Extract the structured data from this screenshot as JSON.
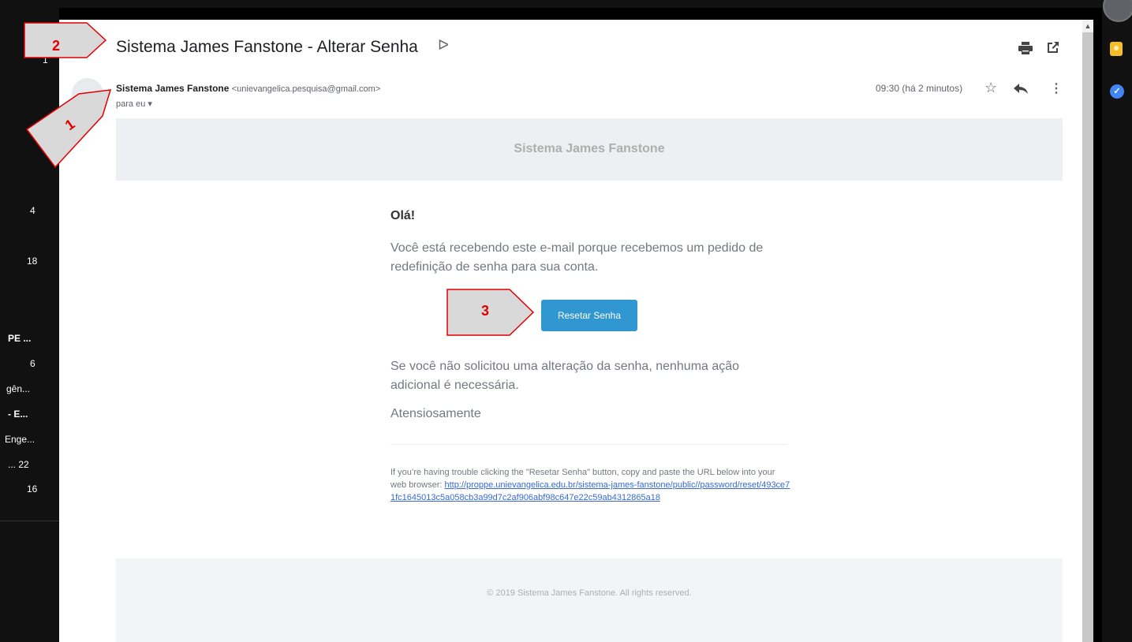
{
  "left_panel": {
    "items": [
      {
        "text": "1",
        "bold": false
      },
      {
        "text": "4",
        "bold": false
      },
      {
        "text": "18",
        "bold": false
      },
      {
        "text": "PE ...",
        "bold": true
      },
      {
        "text": "6",
        "bold": false
      },
      {
        "text": "gên...",
        "bold": false
      },
      {
        "text": "- E...",
        "bold": true
      },
      {
        "text": "Enge...",
        "bold": false
      },
      {
        "text": "...  22",
        "bold": false
      },
      {
        "text": "16",
        "bold": false
      }
    ]
  },
  "email": {
    "subject": "Sistema James Fanstone - Alterar Senha",
    "importance_marker": "ᐅ",
    "sender_name": "Sistema James Fanstone",
    "sender_email": "<unievangelica.pesquisa@gmail.com>",
    "recipient": "para eu ▾",
    "date": "09:30 (há 2 minutos)",
    "body": {
      "header_title": "Sistema James Fanstone",
      "greeting": "Olá!",
      "intro": "Você está recebendo este e-mail porque recebemos um pedido de redefinição de senha para sua conta.",
      "button_label": "Resetar Senha",
      "outro": "Se você não solicitou uma alteração da senha, nenhuma ação adicional é necessária.",
      "signoff": "Atensiosamente",
      "trouble_text": "If you’re having trouble clicking the \"Resetar Senha\" button, copy and paste the URL below into your web browser:",
      "reset_url": "http://proppe.unievangelica.edu.br/sistema-james-fanstone/public//password/reset/493ce71fc1645013c5a058cb3a99d7c2af906abf98c647e22c59ab4312865a18",
      "footer": "© 2019 Sistema James Fanstone. All rights reserved."
    }
  },
  "callouts": [
    "1",
    "2",
    "3"
  ],
  "colors": {
    "button": "#3097d1",
    "callout_fill": "#d9d9d9",
    "callout_stroke": "#e00000",
    "link": "#3869d4"
  }
}
